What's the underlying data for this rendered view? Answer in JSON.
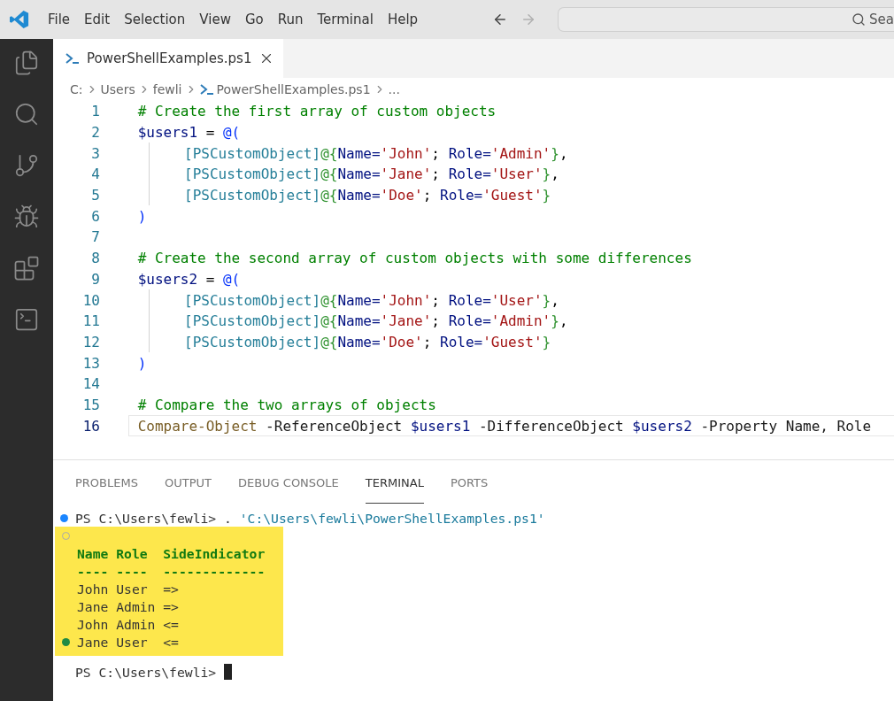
{
  "menu": [
    "File",
    "Edit",
    "Selection",
    "View",
    "Go",
    "Run",
    "Terminal",
    "Help"
  ],
  "nav": {
    "back_disabled": false,
    "forward_disabled": true
  },
  "search": {
    "placeholder": "Sea"
  },
  "activity_bar": [
    {
      "kind": "explorer",
      "selected": false
    },
    {
      "kind": "search",
      "selected": false
    },
    {
      "kind": "source-control",
      "selected": false
    },
    {
      "kind": "run-debug",
      "selected": false
    },
    {
      "kind": "extensions",
      "selected": false
    },
    {
      "kind": "terminal",
      "selected": false
    }
  ],
  "tabs": [
    {
      "label": "PowerShellExamples.ps1",
      "selected": true
    }
  ],
  "breadcrumb": [
    {
      "label": "C:",
      "kind": "folder"
    },
    {
      "label": "Users",
      "kind": "folder"
    },
    {
      "label": "fewli",
      "kind": "folder"
    },
    {
      "label": "PowerShellExamples.ps1",
      "kind": "file"
    },
    {
      "label": "...",
      "kind": "more"
    }
  ],
  "code_lines": [
    {
      "number": "1",
      "current": false,
      "indented": false,
      "tokens": [
        {
          "kind": "comment",
          "text": "# Create the first array of custom objects"
        }
      ]
    },
    {
      "number": "2",
      "current": false,
      "indented": false,
      "tokens": [
        {
          "kind": "variable",
          "text": "$users1"
        },
        {
          "kind": "plain",
          "text": " = "
        },
        {
          "kind": "paren",
          "text": "@("
        }
      ]
    },
    {
      "number": "3",
      "current": false,
      "indented": true,
      "tokens": [
        {
          "kind": "type",
          "text": "[PSCustomObject]"
        },
        {
          "kind": "brace",
          "text": "@{"
        },
        {
          "kind": "key",
          "text": "Name="
        },
        {
          "kind": "string",
          "text": "'John'"
        },
        {
          "kind": "plain",
          "text": "; "
        },
        {
          "kind": "key",
          "text": "Role="
        },
        {
          "kind": "string",
          "text": "'Admin'"
        },
        {
          "kind": "brace",
          "text": "}"
        },
        {
          "kind": "plain",
          "text": ","
        }
      ]
    },
    {
      "number": "4",
      "current": false,
      "indented": true,
      "tokens": [
        {
          "kind": "type",
          "text": "[PSCustomObject]"
        },
        {
          "kind": "brace",
          "text": "@{"
        },
        {
          "kind": "key",
          "text": "Name="
        },
        {
          "kind": "string",
          "text": "'Jane'"
        },
        {
          "kind": "plain",
          "text": "; "
        },
        {
          "kind": "key",
          "text": "Role="
        },
        {
          "kind": "string",
          "text": "'User'"
        },
        {
          "kind": "brace",
          "text": "}"
        },
        {
          "kind": "plain",
          "text": ","
        }
      ]
    },
    {
      "number": "5",
      "current": false,
      "indented": true,
      "tokens": [
        {
          "kind": "type",
          "text": "[PSCustomObject]"
        },
        {
          "kind": "brace",
          "text": "@{"
        },
        {
          "kind": "key",
          "text": "Name="
        },
        {
          "kind": "string",
          "text": "'Doe'"
        },
        {
          "kind": "plain",
          "text": "; "
        },
        {
          "kind": "key",
          "text": "Role="
        },
        {
          "kind": "string",
          "text": "'Guest'"
        },
        {
          "kind": "brace",
          "text": "}"
        }
      ]
    },
    {
      "number": "6",
      "current": false,
      "indented": false,
      "tokens": [
        {
          "kind": "paren",
          "text": ")"
        }
      ]
    },
    {
      "number": "7",
      "current": false,
      "indented": false
    },
    {
      "number": "8",
      "current": false,
      "indented": false,
      "tokens": [
        {
          "kind": "comment",
          "text": "# Create the second array of custom objects with some differences"
        }
      ]
    },
    {
      "number": "9",
      "current": false,
      "indented": false,
      "tokens": [
        {
          "kind": "variable",
          "text": "$users2"
        },
        {
          "kind": "plain",
          "text": " = "
        },
        {
          "kind": "paren",
          "text": "@("
        }
      ]
    },
    {
      "number": "10",
      "current": false,
      "indented": true,
      "tokens": [
        {
          "kind": "type",
          "text": "[PSCustomObject]"
        },
        {
          "kind": "brace",
          "text": "@{"
        },
        {
          "kind": "key",
          "text": "Name="
        },
        {
          "kind": "string",
          "text": "'John'"
        },
        {
          "kind": "plain",
          "text": "; "
        },
        {
          "kind": "key",
          "text": "Role="
        },
        {
          "kind": "string",
          "text": "'User'"
        },
        {
          "kind": "brace",
          "text": "}"
        },
        {
          "kind": "plain",
          "text": ","
        }
      ]
    },
    {
      "number": "11",
      "current": false,
      "indented": true,
      "tokens": [
        {
          "kind": "type",
          "text": "[PSCustomObject]"
        },
        {
          "kind": "brace",
          "text": "@{"
        },
        {
          "kind": "key",
          "text": "Name="
        },
        {
          "kind": "string",
          "text": "'Jane'"
        },
        {
          "kind": "plain",
          "text": "; "
        },
        {
          "kind": "key",
          "text": "Role="
        },
        {
          "kind": "string",
          "text": "'Admin'"
        },
        {
          "kind": "brace",
          "text": "}"
        },
        {
          "kind": "plain",
          "text": ","
        }
      ]
    },
    {
      "number": "12",
      "current": false,
      "indented": true,
      "tokens": [
        {
          "kind": "type",
          "text": "[PSCustomObject]"
        },
        {
          "kind": "brace",
          "text": "@{"
        },
        {
          "kind": "key",
          "text": "Name="
        },
        {
          "kind": "string",
          "text": "'Doe'"
        },
        {
          "kind": "plain",
          "text": "; "
        },
        {
          "kind": "key",
          "text": "Role="
        },
        {
          "kind": "string",
          "text": "'Guest'"
        },
        {
          "kind": "brace",
          "text": "}"
        }
      ]
    },
    {
      "number": "13",
      "current": false,
      "indented": false,
      "tokens": [
        {
          "kind": "paren",
          "text": ")"
        }
      ]
    },
    {
      "number": "14",
      "current": false,
      "indented": false
    },
    {
      "number": "15",
      "current": false,
      "indented": false,
      "tokens": [
        {
          "kind": "comment",
          "text": "# Compare the two arrays of objects"
        }
      ]
    },
    {
      "number": "16",
      "current": true,
      "indented": false,
      "tokens": [
        {
          "kind": "cmdlet",
          "text": "Compare-Object"
        },
        {
          "kind": "param",
          "text": " -ReferenceObject "
        },
        {
          "kind": "variable",
          "text": "$users1"
        },
        {
          "kind": "param",
          "text": " -DifferenceObject "
        },
        {
          "kind": "variable",
          "text": "$users2"
        },
        {
          "kind": "param",
          "text": " -Property Name, Role"
        }
      ]
    }
  ],
  "panel_tabs": [
    {
      "label": "PROBLEMS",
      "selected": false
    },
    {
      "label": "OUTPUT",
      "selected": false
    },
    {
      "label": "DEBUG CONSOLE",
      "selected": false
    },
    {
      "label": "TERMINAL",
      "selected": true
    },
    {
      "label": "PORTS",
      "selected": false
    }
  ],
  "terminal": {
    "command": {
      "prompt": "PS C:\\Users\\fewli>",
      "operator": ".",
      "path": "'C:\\Users\\fewli\\PowerShellExamples.ps1'",
      "marker": {
        "kind": "filled",
        "color": "#1a85ff"
      }
    },
    "output": {
      "highlighted": true,
      "lines": [
        {
          "kind": "blank",
          "marker": {
            "kind": "hollow"
          }
        },
        {
          "kind": "header",
          "text": "Name Role  SideIndicator"
        },
        {
          "kind": "rule",
          "text": "---- ----  -------------"
        },
        {
          "kind": "row",
          "text": "John User  =>"
        },
        {
          "kind": "row",
          "text": "Jane Admin =>"
        },
        {
          "kind": "row",
          "text": "John Admin <="
        },
        {
          "kind": "row",
          "text": "Jane User  <=",
          "marker": {
            "kind": "filled",
            "color": "#1f8a44"
          }
        }
      ]
    },
    "prompt": {
      "text": "PS C:\\Users\\fewli>",
      "cursor": true
    }
  }
}
